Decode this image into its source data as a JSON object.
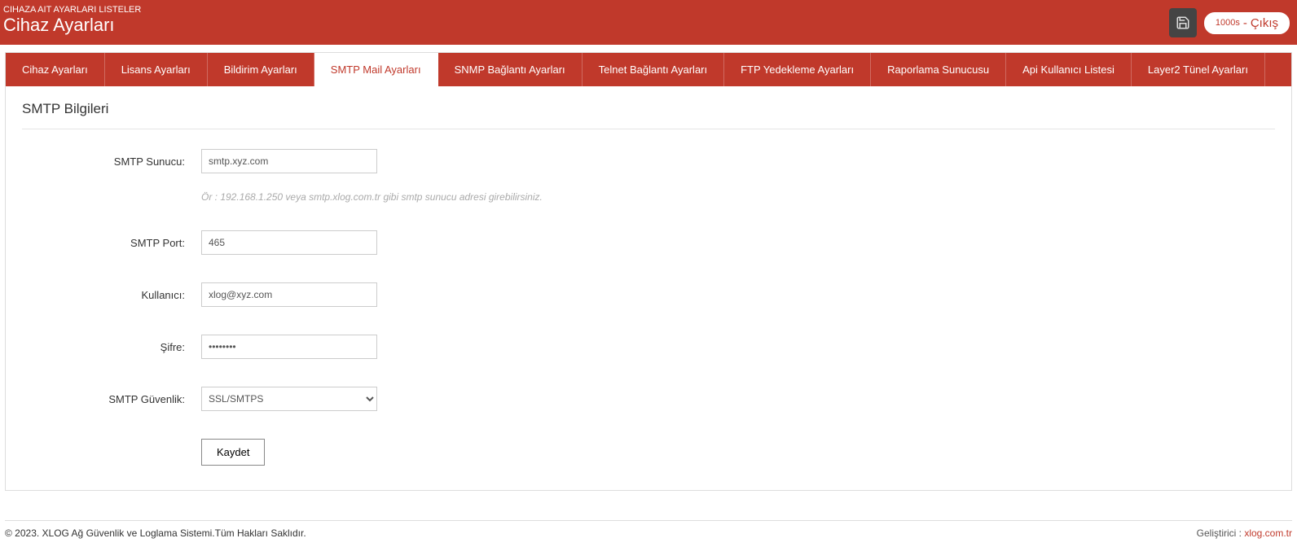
{
  "header": {
    "subtitle": "CIHAZA AIT AYARLARI LISTELER",
    "title": "Cihaz Ayarları",
    "session_seconds": "1000s",
    "session_sep": " - ",
    "logout_label": "Çıkış"
  },
  "tabs": [
    {
      "label": "Cihaz Ayarları"
    },
    {
      "label": "Lisans Ayarları"
    },
    {
      "label": "Bildirim Ayarları"
    },
    {
      "label": "SMTP Mail Ayarları"
    },
    {
      "label": "SNMP Bağlantı Ayarları"
    },
    {
      "label": "Telnet Bağlantı Ayarları"
    },
    {
      "label": "FTP Yedekleme Ayarları"
    },
    {
      "label": "Raporlama Sunucusu"
    },
    {
      "label": "Api Kullanıcı Listesi"
    },
    {
      "label": "Layer2 Tünel Ayarları"
    }
  ],
  "section": {
    "title": "SMTP Bilgileri"
  },
  "form": {
    "smtp_server_label": "SMTP Sunucu:",
    "smtp_server_value": "smtp.xyz.com",
    "smtp_server_help": "Ör : 192.168.1.250 veya smtp.xlog.com.tr gibi smtp sunucu adresi girebilirsiniz.",
    "smtp_port_label": "SMTP Port:",
    "smtp_port_value": "465",
    "user_label": "Kullanıcı:",
    "user_value": "xlog@xyz.com",
    "password_label": "Şifre:",
    "password_value": "••••••••",
    "security_label": "SMTP Güvenlik:",
    "security_value": "SSL/SMTPS",
    "save_label": "Kaydet"
  },
  "footer": {
    "copyright": "© 2023. XLOG Ağ Güvenlik ve Loglama Sistemi.Tüm Hakları Saklıdır.",
    "developer_label": "Geliştirici : ",
    "developer_link": "xlog.com.tr"
  }
}
